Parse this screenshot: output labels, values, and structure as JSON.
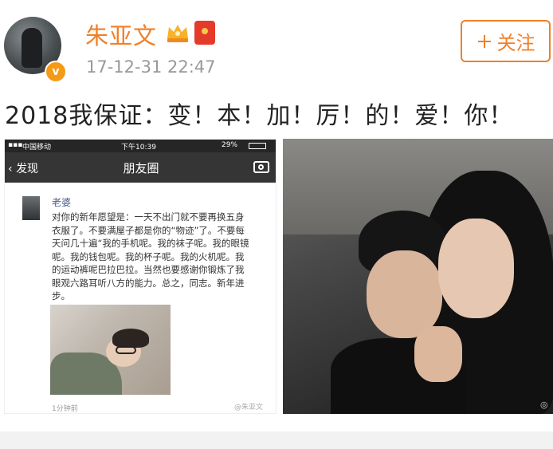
{
  "header": {
    "username": "朱亚文",
    "timestamp": "17-12-31 22:47",
    "follow_label": "关注",
    "follow_icon": "plus-icon",
    "verified_mark": "v"
  },
  "post": {
    "text": "2018我保证：变！本！加！厉！的！爱！你！"
  },
  "screenshot": {
    "status_carrier": "中国移动",
    "status_time": "下午10:39",
    "status_battery": "29%",
    "back_label": "发现",
    "title": "朋友圈",
    "moment": {
      "author": "老婆",
      "body": "对你的新年愿望是：一天不出门就不要再换五身衣服了。不要满屋子都是你的“物迹”了。不要每天问几十遍“我的手机呢。我的袜子呢。我的眼镜呢。我的钱包呢。我的杯子呢。我的火机呢。我的运动裤呢巴拉巴拉。当然也要感谢你锻炼了我眼观六路耳听八方的能力。总之，同志。新年进步。",
      "time": "1分钟前",
      "watermark": "@朱亚文"
    }
  },
  "selfie": {
    "watermark": "◎"
  },
  "colors": {
    "accent": "#f0802a",
    "verified": "#f59a16",
    "nav_bg": "#353535",
    "link": "#4a5c8a"
  }
}
